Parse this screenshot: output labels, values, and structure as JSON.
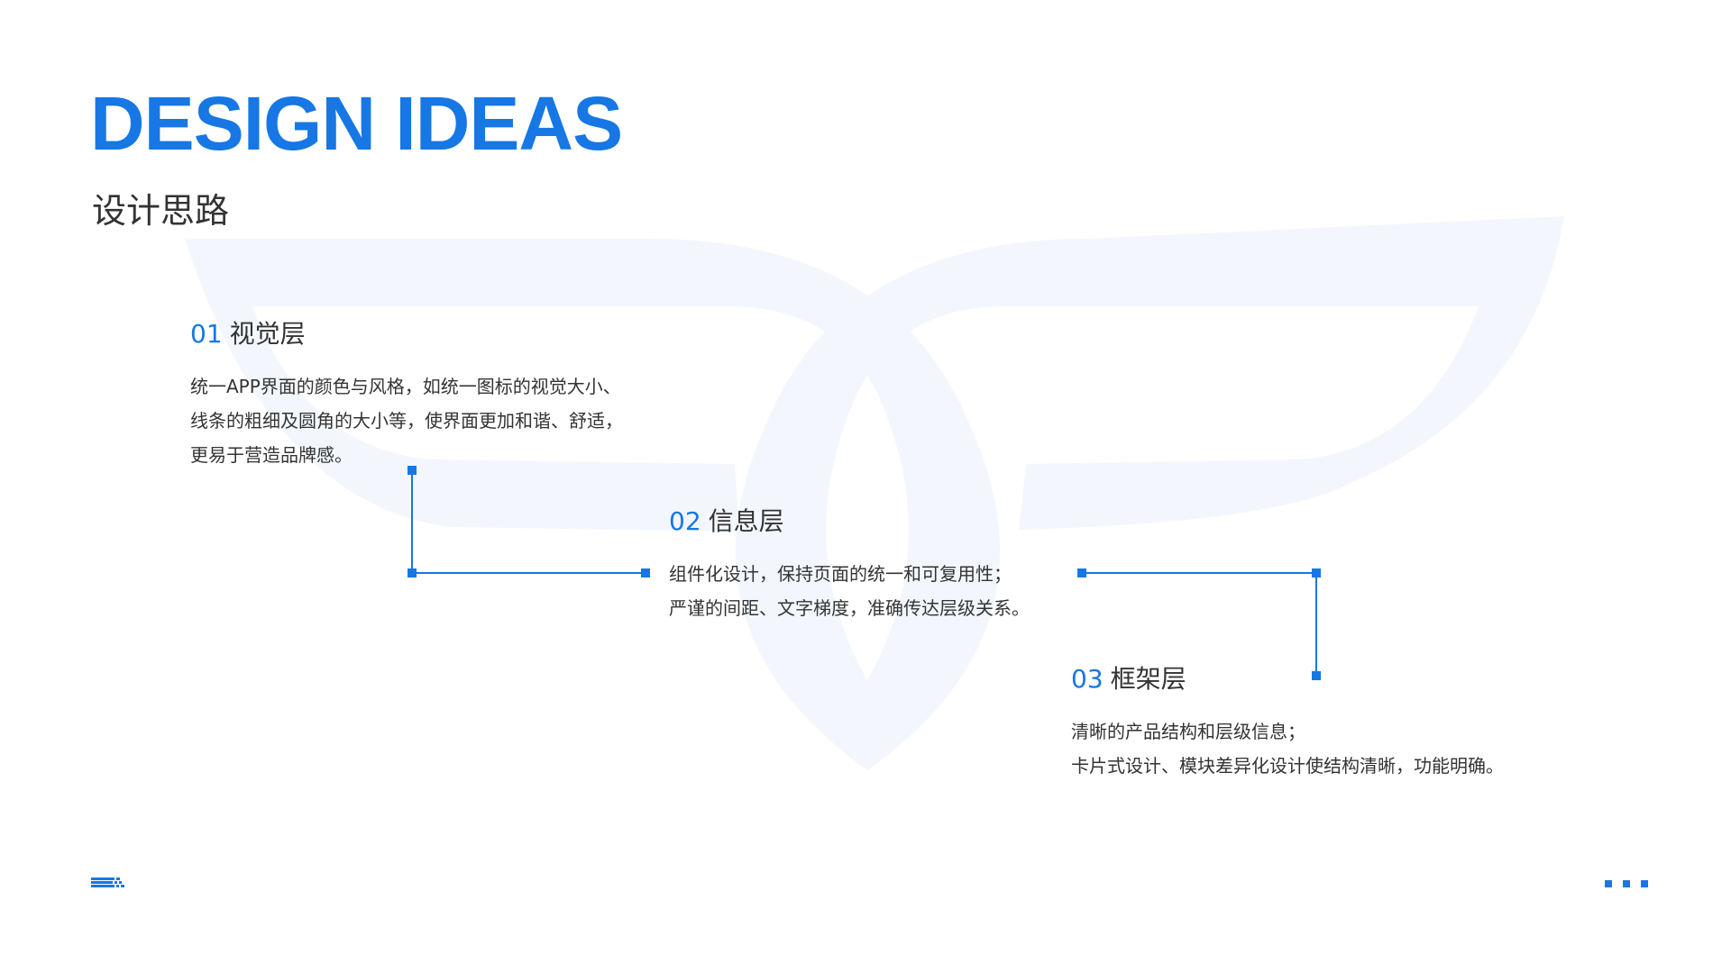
{
  "title": "DESIGN IDEAS",
  "subtitle": "设计思路",
  "colors": {
    "accent": "#1677e5",
    "text": "#333333",
    "watermark": "#f3f7fd"
  },
  "sections": [
    {
      "number": "01",
      "title": "视觉层",
      "lines": [
        "统一APP界面的颜色与风格，如统一图标的视觉大小、",
        "线条的粗细及圆角的大小等，使界面更加和谐、舒适，",
        "更易于营造品牌感。"
      ]
    },
    {
      "number": "02",
      "title": "信息层",
      "lines": [
        "组件化设计，保持页面的统一和可复用性；",
        "严谨的间距、文字梯度，准确传达层级关系。"
      ]
    },
    {
      "number": "03",
      "title": "框架层",
      "lines": [
        "清晰的产品结构和层级信息；",
        "卡片式设计、模块差异化设计使结构清晰，功能明确。"
      ]
    }
  ],
  "icons": {
    "footer_left": "menu-lines-icon",
    "footer_right": "dots-icon"
  }
}
